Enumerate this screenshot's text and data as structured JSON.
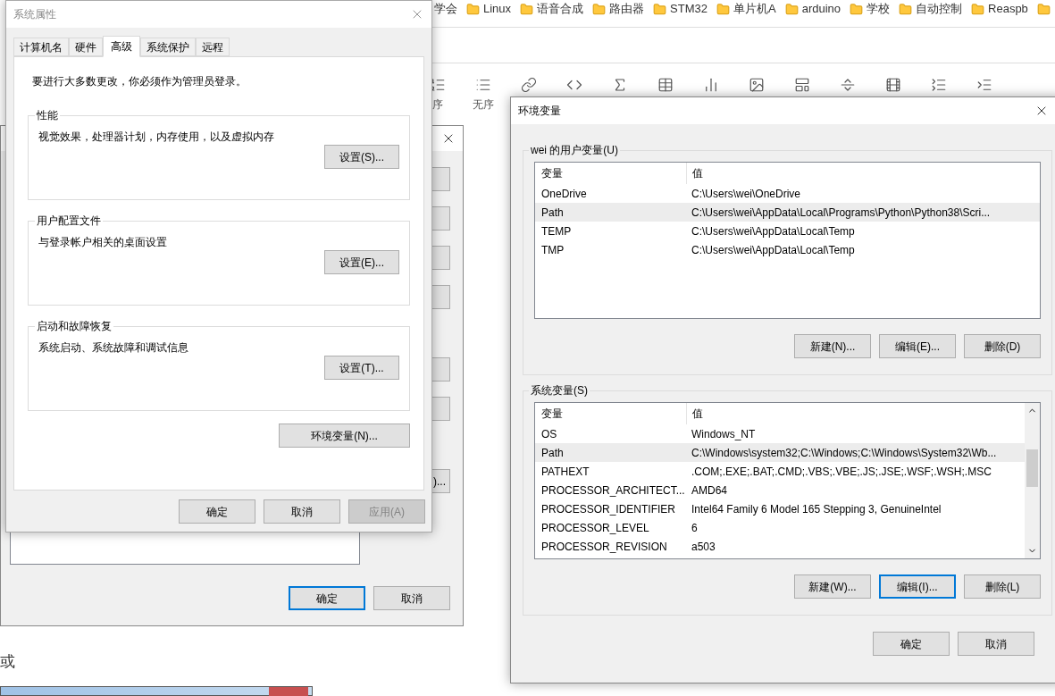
{
  "browser": {
    "bookmarks": [
      {
        "label": "学会"
      },
      {
        "label": "Linux"
      },
      {
        "label": "语音合成"
      },
      {
        "label": "路由器"
      },
      {
        "label": "STM32"
      },
      {
        "label": "单片机A"
      },
      {
        "label": "arduino"
      },
      {
        "label": "学校"
      },
      {
        "label": "自动控制"
      },
      {
        "label": "Reaspb"
      }
    ],
    "toolbar_labels": [
      "序",
      "无序"
    ],
    "body_text": "或"
  },
  "back_dialog": {
    "side_button_text": ")...",
    "buttons": [
      {
        "label": "确定",
        "focused": true
      },
      {
        "label": "取消",
        "focused": false
      }
    ]
  },
  "system_properties": {
    "title": "系统属性",
    "tabs": [
      {
        "label": "计算机名",
        "selected": false
      },
      {
        "label": "硬件",
        "selected": false
      },
      {
        "label": "高级",
        "selected": true
      },
      {
        "label": "系统保护",
        "selected": false
      },
      {
        "label": "远程",
        "selected": false
      }
    ],
    "notice": "要进行大多数更改，你必须作为管理员登录。",
    "groups": [
      {
        "title": "性能",
        "description": "视觉效果，处理器计划，内存使用，以及虚拟内存",
        "button": "设置(S)..."
      },
      {
        "title": "用户配置文件",
        "description": "与登录帐户相关的桌面设置",
        "button": "设置(E)..."
      },
      {
        "title": "启动和故障恢复",
        "description": "系统启动、系统故障和调试信息",
        "button": "设置(T)..."
      }
    ],
    "env_button": "环境变量(N)...",
    "buttons": [
      {
        "label": "确定",
        "disabled": false
      },
      {
        "label": "取消",
        "disabled": false
      },
      {
        "label": "应用(A)",
        "disabled": true
      }
    ]
  },
  "environment_variables": {
    "title": "环境变量",
    "sections": [
      {
        "title": "wei 的用户变量(U)",
        "columns": [
          "变量",
          "值"
        ],
        "scrollbar": false,
        "rows": [
          {
            "name": "OneDrive",
            "value": "C:\\Users\\wei\\OneDrive",
            "selected": false
          },
          {
            "name": "Path",
            "value": "C:\\Users\\wei\\AppData\\Local\\Programs\\Python\\Python38\\Scri...",
            "selected": true
          },
          {
            "name": "TEMP",
            "value": "C:\\Users\\wei\\AppData\\Local\\Temp",
            "selected": false
          },
          {
            "name": "TMP",
            "value": "C:\\Users\\wei\\AppData\\Local\\Temp",
            "selected": false
          }
        ],
        "buttons": [
          {
            "label": "新建(N)...",
            "focused": false
          },
          {
            "label": "编辑(E)...",
            "focused": false
          },
          {
            "label": "删除(D)",
            "focused": false
          }
        ]
      },
      {
        "title": "系统变量(S)",
        "columns": [
          "变量",
          "值"
        ],
        "scrollbar": true,
        "rows": [
          {
            "name": "OS",
            "value": "Windows_NT",
            "selected": false
          },
          {
            "name": "Path",
            "value": "C:\\Windows\\system32;C:\\Windows;C:\\Windows\\System32\\Wb...",
            "selected": true
          },
          {
            "name": "PATHEXT",
            "value": ".COM;.EXE;.BAT;.CMD;.VBS;.VBE;.JS;.JSE;.WSF;.WSH;.MSC",
            "selected": false
          },
          {
            "name": "PROCESSOR_ARCHITECT...",
            "value": "AMD64",
            "selected": false
          },
          {
            "name": "PROCESSOR_IDENTIFIER",
            "value": "Intel64 Family 6 Model 165 Stepping 3, GenuineIntel",
            "selected": false
          },
          {
            "name": "PROCESSOR_LEVEL",
            "value": "6",
            "selected": false
          },
          {
            "name": "PROCESSOR_REVISION",
            "value": "a503",
            "selected": false
          }
        ],
        "buttons": [
          {
            "label": "新建(W)...",
            "focused": false
          },
          {
            "label": "编辑(I)...",
            "focused": true
          },
          {
            "label": "删除(L)",
            "focused": false
          }
        ]
      }
    ],
    "buttons": [
      {
        "label": "确定",
        "focused": false
      },
      {
        "label": "取消",
        "focused": false
      }
    ]
  }
}
